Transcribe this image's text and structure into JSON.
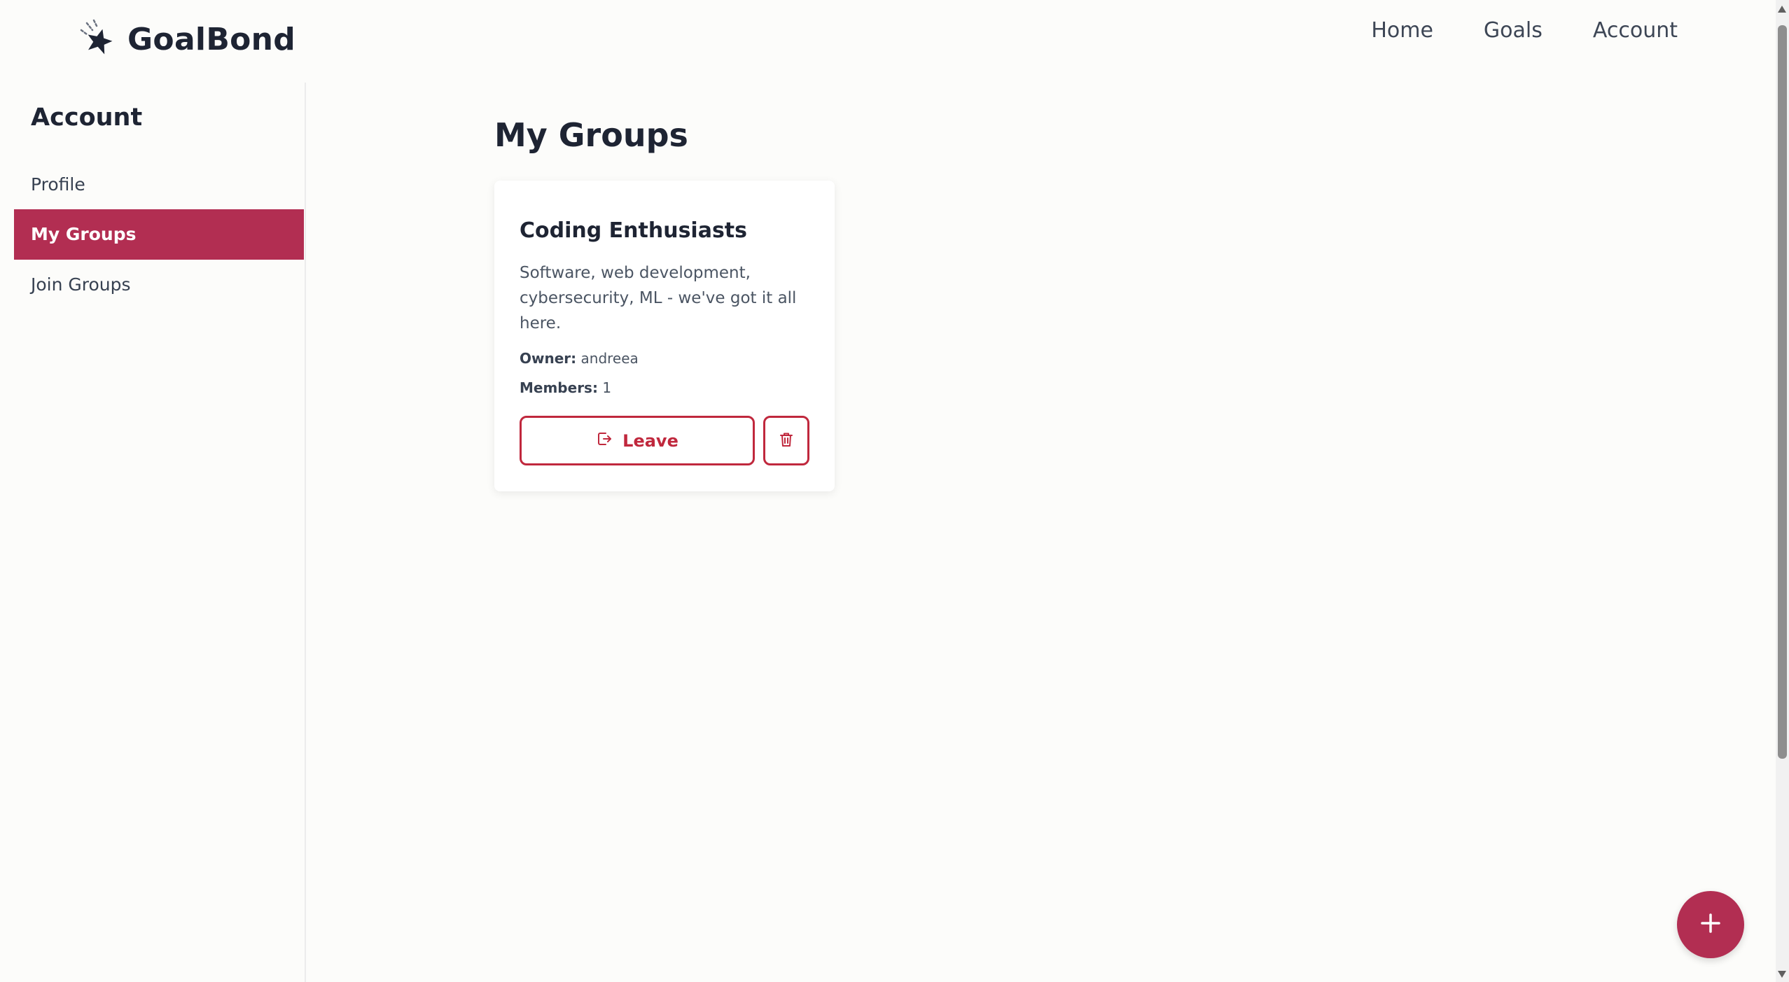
{
  "header": {
    "brand": "GoalBond",
    "brand_icon": "star-logo-icon",
    "nav": [
      {
        "label": "Home"
      },
      {
        "label": "Goals"
      },
      {
        "label": "Account"
      }
    ]
  },
  "sidebar": {
    "title": "Account",
    "items": [
      {
        "label": "Profile",
        "active": false
      },
      {
        "label": "My Groups",
        "active": true
      },
      {
        "label": "Join Groups",
        "active": false
      }
    ]
  },
  "main": {
    "title": "My Groups",
    "groups": [
      {
        "name": "Coding Enthusiasts",
        "description": "Software, web development, cybersecurity, ML - we've got it all here.",
        "owner_label": "Owner:",
        "owner": "andreea",
        "members_label": "Members:",
        "members": "1",
        "leave_label": "Leave",
        "leave_icon": "logout-icon",
        "delete_icon": "trash-icon"
      }
    ]
  },
  "fab": {
    "icon": "plus-icon"
  },
  "colors": {
    "accent": "#b22e52",
    "danger": "#c0283d",
    "text_dark": "#1e2433",
    "background": "#fcfcfa"
  }
}
